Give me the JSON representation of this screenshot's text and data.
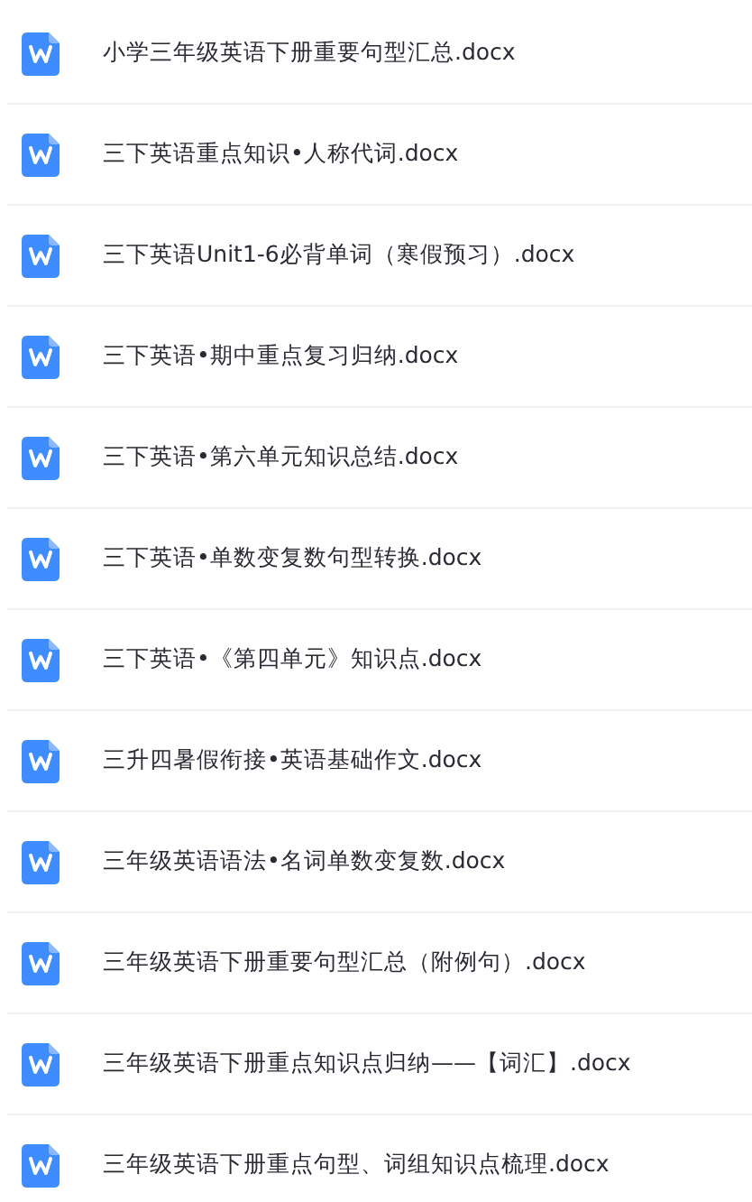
{
  "files": [
    {
      "name": "小学三年级英语下册重要句型汇总.docx"
    },
    {
      "name": "三下英语重点知识•人称代词.docx"
    },
    {
      "name": "三下英语Unit1-6必背单词（寒假预习）.docx"
    },
    {
      "name": "三下英语•期中重点复习归纳.docx"
    },
    {
      "name": "三下英语•第六单元知识总结.docx"
    },
    {
      "name": "三下英语•单数变复数句型转换.docx"
    },
    {
      "name": "三下英语•《第四单元》知识点.docx"
    },
    {
      "name": "三升四暑假衔接•英语基础作文.docx"
    },
    {
      "name": "三年级英语语法•名词单数变复数.docx"
    },
    {
      "name": "三年级英语下册重要句型汇总（附例句）.docx"
    },
    {
      "name": "三年级英语下册重点知识点归纳——【词汇】.docx"
    },
    {
      "name": "三年级英语下册重点句型、词组知识点梳理.docx"
    }
  ]
}
